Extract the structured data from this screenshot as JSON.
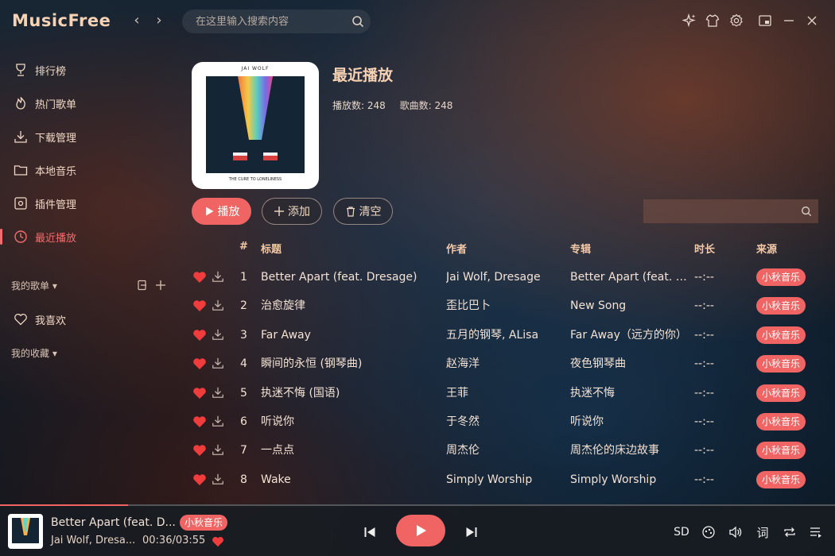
{
  "app": {
    "name": "MusicFree"
  },
  "search": {
    "placeholder": "在这里输入搜索内容"
  },
  "sidebar": {
    "items": [
      {
        "label": "排行榜",
        "icon": "trophy-icon"
      },
      {
        "label": "热门歌单",
        "icon": "fire-icon"
      },
      {
        "label": "下载管理",
        "icon": "download-icon"
      },
      {
        "label": "本地音乐",
        "icon": "folder-icon"
      },
      {
        "label": "插件管理",
        "icon": "plugin-icon"
      },
      {
        "label": "最近播放",
        "icon": "clock-icon",
        "active": true
      }
    ],
    "my_playlists": "我的歌单",
    "favorites": "我喜欢",
    "my_collections": "我的收藏"
  },
  "header": {
    "title": "最近播放",
    "cover": {
      "artist": "JAI WOLF",
      "album": "THE CURE TO LONELINESS"
    },
    "play_count_label": "播放数: 248",
    "song_count_label": "歌曲数: 248"
  },
  "actions": {
    "play": "播放",
    "add": "添加",
    "clear": "清空"
  },
  "table": {
    "headers": {
      "index": "#",
      "title": "标题",
      "artist": "作者",
      "album": "专辑",
      "duration": "时长",
      "source": "来源"
    },
    "rows": [
      {
        "index": "1",
        "title": "Better Apart (feat. Dresage)",
        "artist": "Jai Wolf, Dresage",
        "album": "Better Apart (feat. Dresage)",
        "duration": "--:--",
        "source": "小秋音乐"
      },
      {
        "index": "2",
        "title": "治愈旋律",
        "artist": "歪比巴卜",
        "album": "New Song",
        "duration": "--:--",
        "source": "小秋音乐"
      },
      {
        "index": "3",
        "title": "Far Away",
        "artist": "五月的钢琴, ALisa",
        "album": "Far Away（远方的你）",
        "duration": "--:--",
        "source": "小秋音乐"
      },
      {
        "index": "4",
        "title": "瞬间的永恒 (钢琴曲)",
        "artist": "赵海洋",
        "album": "夜色钢琴曲",
        "duration": "--:--",
        "source": "小秋音乐"
      },
      {
        "index": "5",
        "title": "执迷不悔 (国语)",
        "artist": "王菲",
        "album": "执迷不悔",
        "duration": "--:--",
        "source": "小秋音乐"
      },
      {
        "index": "6",
        "title": "听说你",
        "artist": "于冬然",
        "album": "听说你",
        "duration": "--:--",
        "source": "小秋音乐"
      },
      {
        "index": "7",
        "title": "一点点",
        "artist": "周杰伦",
        "album": "周杰伦的床边故事",
        "duration": "--:--",
        "source": "小秋音乐"
      },
      {
        "index": "8",
        "title": "Wake",
        "artist": "Simply Worship",
        "album": "Simply Worship",
        "duration": "--:--",
        "source": "小秋音乐"
      }
    ]
  },
  "player": {
    "title": "Better Apart (feat. D...",
    "source": "小秋音乐",
    "artist": "Jai Wolf, Dresa...",
    "time": "00:36/03:55",
    "progress": 0.153,
    "quality": "SD",
    "lyric": "词"
  },
  "colors": {
    "accent": "#f06464",
    "title": "#f7d2b4"
  }
}
